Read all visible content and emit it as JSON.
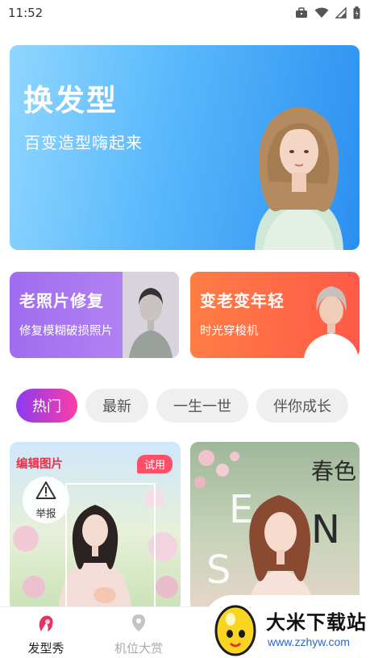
{
  "status_bar": {
    "time": "11:52",
    "icons": [
      "briefcase-icon",
      "wifi-icon",
      "signal-icon",
      "battery-icon"
    ]
  },
  "hero": {
    "title": "换发型",
    "subtitle": "百变造型嗨起来"
  },
  "cards": [
    {
      "title": "老照片修复",
      "subtitle": "修复模糊破损照片"
    },
    {
      "title": "变老变年轻",
      "subtitle": "时光穿梭机"
    }
  ],
  "tabs": [
    "热门",
    "最新",
    "一生一世",
    "伴你成长"
  ],
  "content": {
    "left": {
      "edit_label": "编辑图片",
      "badge": "试用",
      "report": "举报"
    },
    "right": {
      "letters": [
        "E",
        "N",
        "S"
      ],
      "calligraphy": "春色"
    }
  },
  "bottom_nav": [
    {
      "label": "发型秀",
      "icon": "hairstyle-icon",
      "active": true
    },
    {
      "label": "机位大赏",
      "icon": "location-pin-icon",
      "active": false
    }
  ],
  "watermark": {
    "title": "大米下载站",
    "url": "www.zzhyw.com"
  },
  "colors": {
    "hero_start": "#8fd6ff",
    "hero_end": "#2b8ff0",
    "restore": "#a06cf0",
    "age": "#ff5a47",
    "tab_active_start": "#8a3cf0",
    "tab_active_end": "#ff3ca8",
    "badge": "#ff4d6a"
  }
}
